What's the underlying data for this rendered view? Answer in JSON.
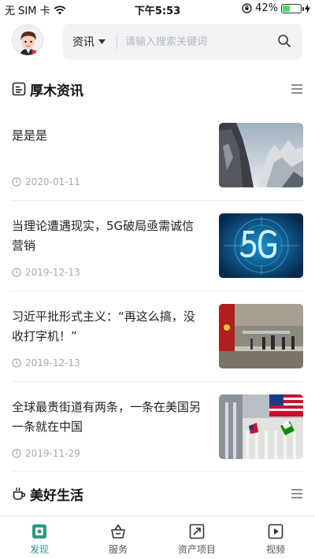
{
  "status_bar": {
    "carrier": "无 SIM 卡",
    "time": "下午5:53",
    "battery": "42%",
    "battery_level": 0.42
  },
  "header": {
    "category": "资讯",
    "search_placeholder": "请输入搜索关键词"
  },
  "sections": [
    {
      "title": "厚木资讯",
      "icon": "news-icon"
    },
    {
      "title": "美好生活",
      "icon": "cup-icon"
    }
  ],
  "news": [
    {
      "title": "是是是",
      "date": "2020-01-11",
      "thumb": "mountain-landscape"
    },
    {
      "title": "当理论遭遇现实，5G破局亟需诚信营销",
      "date": "2019-12-13",
      "thumb": "5g-graphic"
    },
    {
      "title": "习近平批形式主义：“再这么搞，没收打字机！”",
      "date": "2019-12-13",
      "thumb": "meeting-hall"
    },
    {
      "title": "全球最贵街道有两条，一条在美国另一条就在中国",
      "date": "2019-11-29",
      "thumb": "stock-exchange-flags"
    }
  ],
  "tabs": [
    {
      "label": "发现",
      "icon": "discover-icon",
      "active": true
    },
    {
      "label": "服务",
      "icon": "basket-icon",
      "active": false
    },
    {
      "label": "资产项目",
      "icon": "external-link-icon",
      "active": false
    },
    {
      "label": "视频",
      "icon": "play-icon",
      "active": false
    }
  ],
  "colors": {
    "accent": "#2d9a80",
    "search_bg": "#f2f3f5",
    "date_text": "#a6a9ad"
  }
}
